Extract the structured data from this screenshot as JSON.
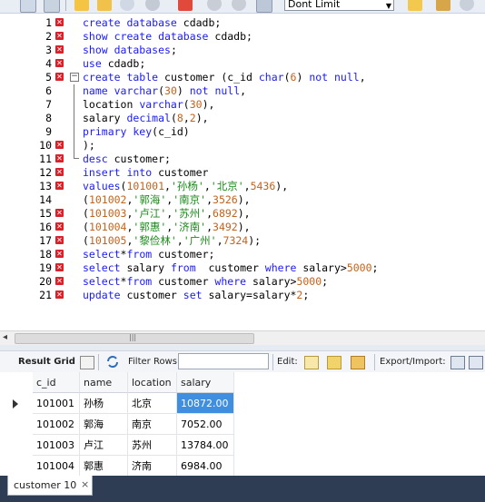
{
  "toolbar": {
    "limit_select_value": "Dont Limit"
  },
  "editor": {
    "lines": [
      {
        "num": "1",
        "error": true
      },
      {
        "num": "2",
        "error": true
      },
      {
        "num": "3",
        "error": true
      },
      {
        "num": "4",
        "error": true
      },
      {
        "num": "5",
        "error": true
      },
      {
        "num": "6",
        "error": false
      },
      {
        "num": "7",
        "error": false
      },
      {
        "num": "8",
        "error": false
      },
      {
        "num": "9",
        "error": false
      },
      {
        "num": "10",
        "error": true
      },
      {
        "num": "11",
        "error": true
      },
      {
        "num": "12",
        "error": true
      },
      {
        "num": "13",
        "error": true
      },
      {
        "num": "14",
        "error": false
      },
      {
        "num": "15",
        "error": true
      },
      {
        "num": "16",
        "error": true
      },
      {
        "num": "17",
        "error": true
      },
      {
        "num": "18",
        "error": true
      },
      {
        "num": "19",
        "error": true
      },
      {
        "num": "20",
        "error": true
      },
      {
        "num": "21",
        "error": true
      }
    ],
    "code": [
      [
        [
          "kw",
          "create database "
        ],
        [
          "",
          "cdadb;"
        ]
      ],
      [
        [
          "kw",
          "show create database "
        ],
        [
          "",
          "cdadb;"
        ]
      ],
      [
        [
          "kw",
          "show databases"
        ],
        [
          "",
          ";"
        ]
      ],
      [
        [
          "kw",
          "use "
        ],
        [
          "",
          "cdadb;"
        ]
      ],
      [
        [
          "kw",
          "create table "
        ],
        [
          "",
          "customer (c_id "
        ],
        [
          "kw",
          "char"
        ],
        [
          "",
          "("
        ],
        [
          "num",
          "6"
        ],
        [
          "",
          ") "
        ],
        [
          "kw",
          "not null"
        ],
        [
          "",
          ","
        ]
      ],
      [
        [
          "kw",
          "name varchar"
        ],
        [
          "",
          "("
        ],
        [
          "num",
          "30"
        ],
        [
          "",
          ") "
        ],
        [
          "kw",
          "not null"
        ],
        [
          "",
          ","
        ]
      ],
      [
        [
          "",
          "location "
        ],
        [
          "kw",
          "varchar"
        ],
        [
          "",
          "("
        ],
        [
          "num",
          "30"
        ],
        [
          "",
          "),"
        ]
      ],
      [
        [
          "",
          "salary "
        ],
        [
          "kw",
          "decimal"
        ],
        [
          "",
          "("
        ],
        [
          "num",
          "8"
        ],
        [
          "",
          ","
        ],
        [
          "num",
          "2"
        ],
        [
          "",
          "),"
        ]
      ],
      [
        [
          "kw",
          "primary key"
        ],
        [
          "",
          "(c_id)"
        ]
      ],
      [
        [
          "",
          ");"
        ]
      ],
      [
        [
          "kw",
          "desc "
        ],
        [
          "",
          "customer;"
        ]
      ],
      [
        [
          "kw",
          "insert into "
        ],
        [
          "",
          "customer"
        ]
      ],
      [
        [
          "kw",
          "values"
        ],
        [
          "",
          "("
        ],
        [
          "num",
          "101001"
        ],
        [
          "",
          ","
        ],
        [
          "str",
          "'孙杨'"
        ],
        [
          "",
          ","
        ],
        [
          "str",
          "'北京'"
        ],
        [
          "",
          ","
        ],
        [
          "num",
          "5436"
        ],
        [
          "",
          "),"
        ]
      ],
      [
        [
          "",
          "("
        ],
        [
          "num",
          "101002"
        ],
        [
          "",
          ","
        ],
        [
          "str",
          "'郭海'"
        ],
        [
          "",
          ","
        ],
        [
          "str",
          "'南京'"
        ],
        [
          "",
          ","
        ],
        [
          "num",
          "3526"
        ],
        [
          "",
          "),"
        ]
      ],
      [
        [
          "",
          "("
        ],
        [
          "num",
          "101003"
        ],
        [
          "",
          ","
        ],
        [
          "str",
          "'卢江'"
        ],
        [
          "",
          ","
        ],
        [
          "str",
          "'苏州'"
        ],
        [
          "",
          ","
        ],
        [
          "num",
          "6892"
        ],
        [
          "",
          "),"
        ]
      ],
      [
        [
          "",
          "("
        ],
        [
          "num",
          "101004"
        ],
        [
          "",
          ","
        ],
        [
          "str",
          "'郭惠'"
        ],
        [
          "",
          ","
        ],
        [
          "str",
          "'济南'"
        ],
        [
          "",
          ","
        ],
        [
          "num",
          "3492"
        ],
        [
          "",
          "),"
        ]
      ],
      [
        [
          "",
          "("
        ],
        [
          "num",
          "101005"
        ],
        [
          "",
          ","
        ],
        [
          "str",
          "'黎俭林'"
        ],
        [
          "",
          ","
        ],
        [
          "str",
          "'广州'"
        ],
        [
          "",
          ","
        ],
        [
          "num",
          "7324"
        ],
        [
          "",
          ");"
        ]
      ],
      [
        [
          "kw",
          "select"
        ],
        [
          "",
          "*"
        ],
        [
          "kw",
          "from "
        ],
        [
          "",
          "customer;"
        ]
      ],
      [
        [
          "kw",
          "select "
        ],
        [
          "",
          "salary "
        ],
        [
          "kw",
          "from  "
        ],
        [
          "",
          "customer "
        ],
        [
          "kw",
          "where "
        ],
        [
          "",
          "salary>"
        ],
        [
          "num",
          "5000"
        ],
        [
          "",
          ";"
        ]
      ],
      [
        [
          "kw",
          "select"
        ],
        [
          "",
          "*"
        ],
        [
          "kw",
          "from "
        ],
        [
          "",
          "customer "
        ],
        [
          "kw",
          "where "
        ],
        [
          "",
          "salary>"
        ],
        [
          "num",
          "5000"
        ],
        [
          "",
          ";"
        ]
      ],
      [
        [
          "kw",
          "update "
        ],
        [
          "",
          "customer "
        ],
        [
          "kw",
          "set "
        ],
        [
          "",
          "salary=salary*"
        ],
        [
          "num",
          "2"
        ],
        [
          "",
          ";"
        ]
      ]
    ]
  },
  "result_toolbar": {
    "result_grid_label": "Result Grid",
    "filter_rows_label": "Filter Rows:",
    "filter_rows_value": "",
    "edit_label": "Edit:",
    "export_import_label": "Export/Import:"
  },
  "grid": {
    "columns": [
      "c_id",
      "name",
      "location",
      "salary"
    ],
    "rows": [
      [
        "101001",
        "孙杨",
        "北京",
        "10872.00"
      ],
      [
        "101002",
        "郭海",
        "南京",
        "7052.00"
      ],
      [
        "101003",
        "卢江",
        "苏州",
        "13784.00"
      ],
      [
        "101004",
        "郭惠",
        "济南",
        "6984.00"
      ]
    ],
    "selected_row": 0,
    "selected_col": 3
  },
  "tabs": {
    "active_label": "customer 10",
    "close_glyph": "×"
  },
  "colors": {
    "keyword": "#1a1aff",
    "string": "#1a8a1a",
    "number": "#c4621a",
    "error_marker": "#d9212a",
    "selection": "#3f8ee0",
    "tabbar_bg": "#2f3d54"
  }
}
